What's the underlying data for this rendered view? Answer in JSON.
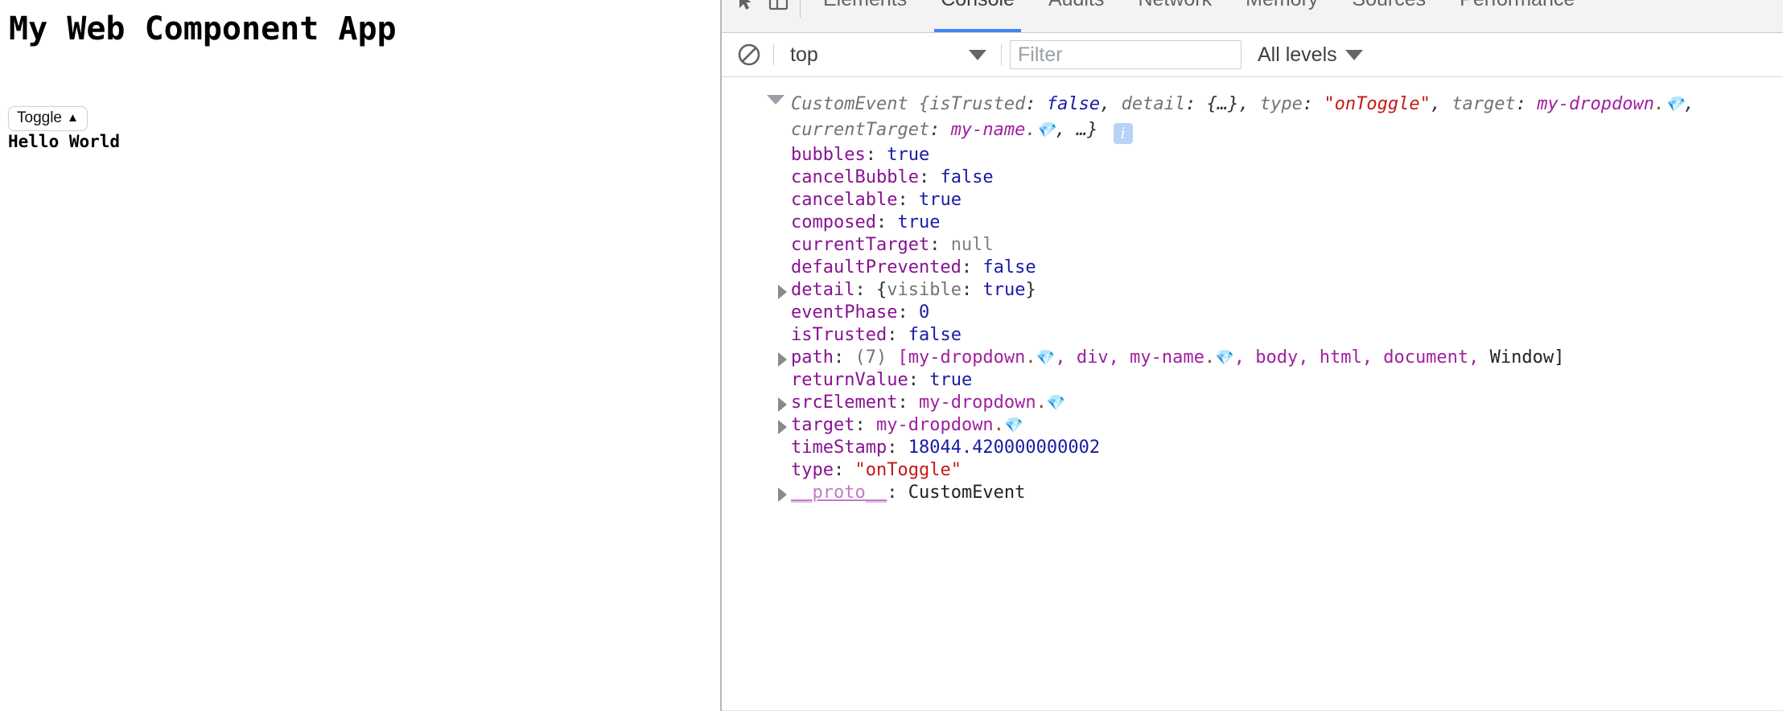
{
  "page": {
    "title": "My Web Component App",
    "toggle_button": {
      "label": "Toggle",
      "caret": "▲"
    },
    "output_text": "Hello World"
  },
  "devtools": {
    "icons": {
      "inspect": "inspect-element-icon",
      "device": "device-toolbar-icon",
      "clear": "clear-console-icon"
    },
    "tabs": [
      {
        "label": "Elements",
        "active": false
      },
      {
        "label": "Console",
        "active": true
      },
      {
        "label": "Audits",
        "active": false
      },
      {
        "label": "Network",
        "active": false
      },
      {
        "label": "Memory",
        "active": false
      },
      {
        "label": "Sources",
        "active": false
      },
      {
        "label": "Performance",
        "active": false
      }
    ],
    "active_tab_color": "#4285f4",
    "toolbar": {
      "context": "top",
      "context_caret": "▼",
      "filter_placeholder": "Filter",
      "filter_value": "",
      "levels": "All levels",
      "levels_caret": "▼"
    },
    "console": {
      "group": {
        "expanded": true,
        "expand_caret": "▼",
        "header": {
          "constructor": "CustomEvent",
          "open_brace": " {",
          "preview": [
            {
              "text": "isTrusted",
              "kind": "dim"
            },
            {
              "text": ": ",
              "kind": "plain"
            },
            {
              "text": "false",
              "kind": "bool"
            },
            {
              "text": ", ",
              "kind": "plain"
            },
            {
              "text": "detail",
              "kind": "dim"
            },
            {
              "text": ": ",
              "kind": "plain"
            },
            {
              "text": "{…}",
              "kind": "plain"
            },
            {
              "text": ", ",
              "kind": "plain"
            },
            {
              "text": "type",
              "kind": "dim"
            },
            {
              "text": ": ",
              "kind": "plain"
            },
            {
              "text": "\"onToggle\"",
              "kind": "string"
            },
            {
              "text": ", ",
              "kind": "plain"
            },
            {
              "text": "target",
              "kind": "dim"
            },
            {
              "text": ": ",
              "kind": "plain"
            },
            {
              "text": "my-dropdown",
              "kind": "node"
            },
            {
              "text": ".",
              "kind": "dot"
            },
            {
              "text": "💎",
              "kind": "gem"
            },
            {
              "text": ", ",
              "kind": "plain"
            },
            {
              "text": "currentTarget",
              "kind": "dim"
            },
            {
              "text": ": ",
              "kind": "plain"
            },
            {
              "text": "my-name",
              "kind": "node"
            },
            {
              "text": ".",
              "kind": "dot"
            },
            {
              "text": "💎",
              "kind": "gem"
            },
            {
              "text": ", …}",
              "kind": "plain"
            }
          ],
          "badge": "i"
        },
        "properties": [
          {
            "expandable": false,
            "name": "bubbles",
            "value": [
              {
                "text": "true",
                "kind": "bool"
              }
            ]
          },
          {
            "expandable": false,
            "name": "cancelBubble",
            "value": [
              {
                "text": "false",
                "kind": "bool"
              }
            ]
          },
          {
            "expandable": false,
            "name": "cancelable",
            "value": [
              {
                "text": "true",
                "kind": "bool"
              }
            ]
          },
          {
            "expandable": false,
            "name": "composed",
            "value": [
              {
                "text": "true",
                "kind": "bool"
              }
            ]
          },
          {
            "expandable": false,
            "name": "currentTarget",
            "value": [
              {
                "text": "null",
                "kind": "null"
              }
            ]
          },
          {
            "expandable": false,
            "name": "defaultPrevented",
            "value": [
              {
                "text": "false",
                "kind": "bool"
              }
            ]
          },
          {
            "expandable": true,
            "name": "detail",
            "value": [
              {
                "text": "{",
                "kind": "plain"
              },
              {
                "text": "visible",
                "kind": "dim"
              },
              {
                "text": ": ",
                "kind": "plain"
              },
              {
                "text": "true",
                "kind": "bool"
              },
              {
                "text": "}",
                "kind": "plain"
              }
            ]
          },
          {
            "expandable": false,
            "name": "eventPhase",
            "value": [
              {
                "text": "0",
                "kind": "num"
              }
            ]
          },
          {
            "expandable": false,
            "name": "isTrusted",
            "value": [
              {
                "text": "false",
                "kind": "bool"
              }
            ]
          },
          {
            "expandable": true,
            "name": "path",
            "value": [
              {
                "text": "(7) ",
                "kind": "dim"
              },
              {
                "text": "[",
                "kind": "node"
              },
              {
                "text": "my-dropdown",
                "kind": "node"
              },
              {
                "text": ".",
                "kind": "dot"
              },
              {
                "text": "💎",
                "kind": "gem"
              },
              {
                "text": ", ",
                "kind": "node"
              },
              {
                "text": "div",
                "kind": "node"
              },
              {
                "text": ", ",
                "kind": "node"
              },
              {
                "text": "my-name",
                "kind": "node"
              },
              {
                "text": ".",
                "kind": "dot"
              },
              {
                "text": "💎",
                "kind": "gem"
              },
              {
                "text": ", ",
                "kind": "node"
              },
              {
                "text": "body",
                "kind": "node"
              },
              {
                "text": ", ",
                "kind": "node"
              },
              {
                "text": "html",
                "kind": "node"
              },
              {
                "text": ", ",
                "kind": "node"
              },
              {
                "text": "document",
                "kind": "node"
              },
              {
                "text": ", ",
                "kind": "node"
              },
              {
                "text": "Window",
                "kind": "ctor"
              },
              {
                "text": "]",
                "kind": "ctor"
              }
            ]
          },
          {
            "expandable": false,
            "name": "returnValue",
            "value": [
              {
                "text": "true",
                "kind": "bool"
              }
            ]
          },
          {
            "expandable": true,
            "name": "srcElement",
            "value": [
              {
                "text": "my-dropdown",
                "kind": "node"
              },
              {
                "text": ".",
                "kind": "dot"
              },
              {
                "text": "💎",
                "kind": "gem"
              }
            ]
          },
          {
            "expandable": true,
            "name": "target",
            "value": [
              {
                "text": "my-dropdown",
                "kind": "node"
              },
              {
                "text": ".",
                "kind": "dot"
              },
              {
                "text": "💎",
                "kind": "gem"
              }
            ]
          },
          {
            "expandable": false,
            "name": "timeStamp",
            "value": [
              {
                "text": "18044.420000000002",
                "kind": "num"
              }
            ]
          },
          {
            "expandable": false,
            "name": "type",
            "value": [
              {
                "text": "\"onToggle\"",
                "kind": "string"
              }
            ]
          },
          {
            "expandable": true,
            "name": "__proto__",
            "name_style": "proto",
            "value": [
              {
                "text": "CustomEvent",
                "kind": "ctor"
              }
            ]
          }
        ]
      }
    }
  }
}
